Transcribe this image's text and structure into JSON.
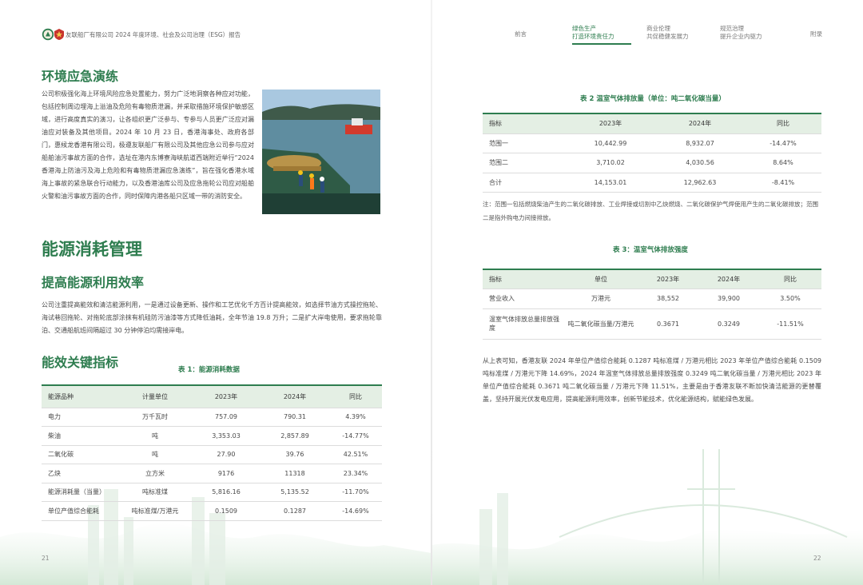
{
  "header": {
    "report_title": "友联船厂有限公司 2024 年度环境、社会及公司治理（ESG）报告",
    "nav": [
      {
        "line1": "前言",
        "line2": ""
      },
      {
        "line1": "绿色生产",
        "line2": "打造环境责任力"
      },
      {
        "line1": "商业伦理",
        "line2": "共促稳健发展力"
      },
      {
        "line1": "规范治理",
        "line2": "提升企业内驱力"
      },
      {
        "line1": "附录",
        "line2": ""
      }
    ]
  },
  "left": {
    "drill_heading": "环境应急演练",
    "drill_paragraph": "公司积极强化海上环境风险应急处置能力，努力广泛地洞察各种应对功能，包括控制周边埋海上溢油及危险有毒物质泄漏，并采取措施环境保护敏感区域，进行高度真实的演习，让各组织更广泛参与、专参与人员更广泛应对漏油应对装备及其他项目。2024 年 10 月 23 日，香港海事处、政府各部门，惠候龙香港有限公司，极遵友联船厂有限公司及其他应急公司参与应对船舶油污事故方面的合作，选址在港内东博寮海峡航道西端附近举行“2024 香港海上防油污及海上危险和有毒物质泄漏应急演练”，旨在强化香港水域海上事故的紧急联合行动能力，以及香港油库公司及应急拖轮公司应对船舶火警和油污事故方面的合作，同时保障内港各船只区域一带的消防安全。",
    "energy_heading": "能源消耗管理",
    "efficiency_heading": "提高能源利用效率",
    "efficiency_paragraph": "公司注重提高能效和清洁能源利用，一是通过设备更新、操作和工艺优化千方百计提高能效，如选择节油方式操控拖轮、海试巷回拖轮、对拖轮底部涂抹有机硅防污油漆等方式降低油耗，全年节油 19.8 万升；二是扩大岸电使用，要求拖轮靠泊、交通船航班间隔超过 30 分钟停泊均需接岸电。",
    "kpi_heading": "能效关键指标",
    "table1": {
      "caption": "表 1：能源消耗数据",
      "headers": [
        "能源品种",
        "计量单位",
        "2023年",
        "2024年",
        "同比"
      ],
      "rows": [
        [
          "电力",
          "万千瓦时",
          "757.09",
          "790.31",
          "4.39%"
        ],
        [
          "柴油",
          "吨",
          "3,353.03",
          "2,857.89",
          "-14.77%"
        ],
        [
          "二氧化碳",
          "吨",
          "27.90",
          "39.76",
          "42.51%"
        ],
        [
          "乙炔",
          "立方米",
          "9176",
          "11318",
          "23.34%"
        ],
        [
          "能源消耗量（当量）",
          "吨标准煤",
          "5,816.16",
          "5,135.52",
          "-11.70%"
        ],
        [
          "单位产值综合能耗",
          "吨标准煤/万港元",
          "0.1509",
          "0.1287",
          "-14.69%"
        ]
      ]
    },
    "page_number": "21"
  },
  "right": {
    "table2": {
      "caption": "表 2  温室气体排放量（单位：吨二氧化碳当量）",
      "headers": [
        "指标",
        "2023年",
        "2024年",
        "同比"
      ],
      "rows": [
        [
          "范围一",
          "10,442.99",
          "8,932.07",
          "-14.47%"
        ],
        [
          "范围二",
          "3,710.02",
          "4,030.56",
          "8.64%"
        ],
        [
          "合计",
          "14,153.01",
          "12,962.63",
          "-8.41%"
        ]
      ]
    },
    "note": "注：范围一包括燃烧柴油产生的二氧化碳排放、工业焊接或切割中乙炔燃烧、二氧化碳保护气焊使用产生的二氧化碳排放；范围二是指外购电力间接排放。",
    "table3": {
      "caption": "表 3：温室气体排放强度",
      "headers": [
        "指标",
        "单位",
        "2023年",
        "2024年",
        "同比"
      ],
      "rows": [
        [
          "营业收入",
          "万港元",
          "38,552",
          "39,900",
          "3.50%"
        ],
        [
          "温室气体排放总量排放强度",
          "吨二氧化碳当量/万港元",
          "0.3671",
          "0.3249",
          "-11.51%"
        ]
      ]
    },
    "summary_paragraph": "从上表可知，香港友联 2024 年单位产值综合能耗 0.1287 吨标准煤 / 万港元相比 2023 年单位产值综合能耗 0.1509 吨标准煤 / 万港元下降 14.69%，2024 年温室气体排放总量排放强度 0.3249 吨二氧化碳当量 / 万港元相比 2023 年单位产值综合能耗 0.3671 吨二氧化碳当量 / 万港元下降 11.51%，主要是由于香港友联不断加快清洁能源的更替覆盖，坚持开展光伏发电应用，提高能源利用效率，创新节能技术，优化能源结构，赋能绿色发展。",
    "page_number": "22"
  },
  "colors": {
    "accent": "#2e7d4f",
    "table_header_bg": "#e4efe4"
  }
}
